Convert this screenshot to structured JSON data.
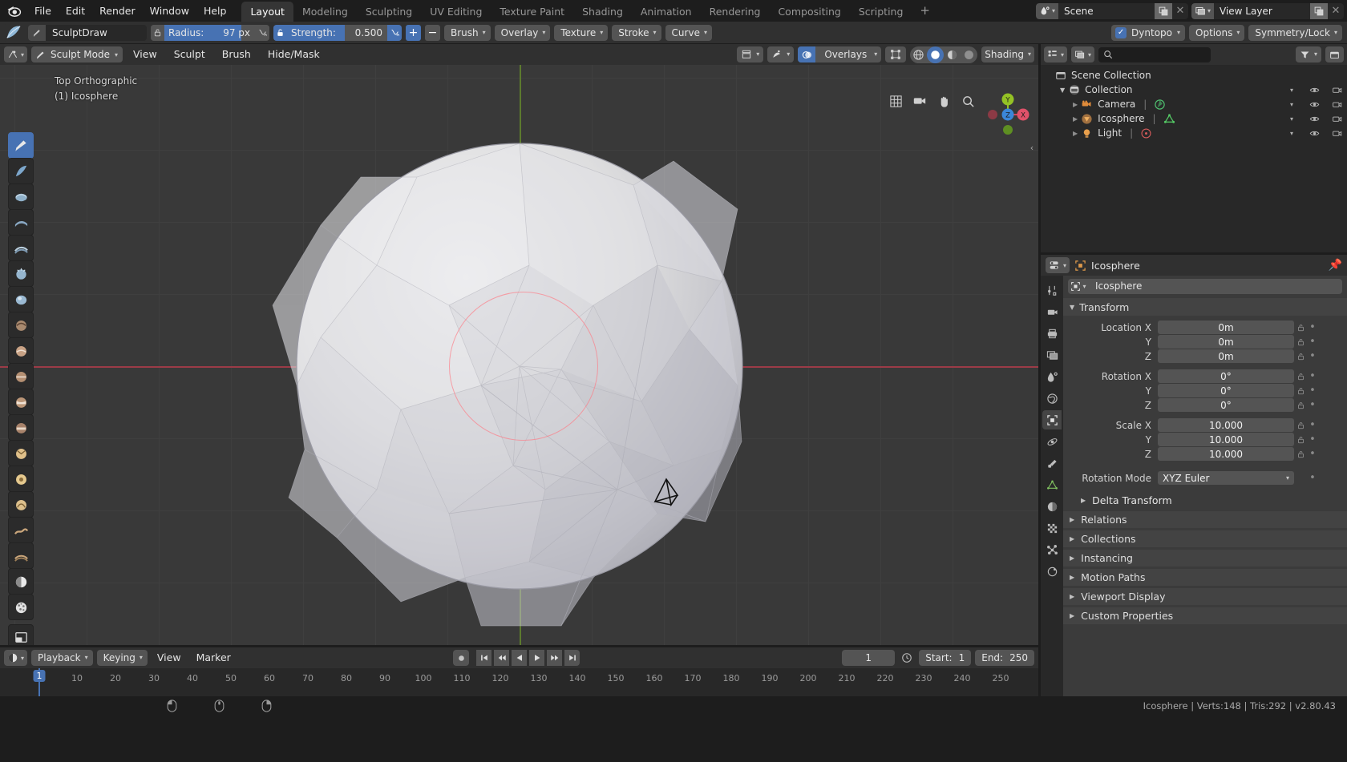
{
  "topbar": {
    "menus": [
      "File",
      "Edit",
      "Render",
      "Window",
      "Help"
    ],
    "workspaces": [
      {
        "label": "Layout",
        "active": true
      },
      {
        "label": "Modeling",
        "active": false
      },
      {
        "label": "Sculpting",
        "active": false
      },
      {
        "label": "UV Editing",
        "active": false
      },
      {
        "label": "Texture Paint",
        "active": false
      },
      {
        "label": "Shading",
        "active": false
      },
      {
        "label": "Animation",
        "active": false
      },
      {
        "label": "Rendering",
        "active": false
      },
      {
        "label": "Compositing",
        "active": false
      },
      {
        "label": "Scripting",
        "active": false
      }
    ],
    "add_workspace": "+",
    "scene_name": "Scene",
    "view_layer_name": "View Layer"
  },
  "toolbar": {
    "brush_name": "SculptDraw",
    "radius_label": "Radius:",
    "radius_value": "97 px",
    "strength_label": "Strength:",
    "strength_value": "0.500",
    "plus": "+",
    "minus": "−",
    "menus": [
      "Brush",
      "Overlay",
      "Texture",
      "Stroke",
      "Curve"
    ],
    "dyntopo_label": "Dyntopo",
    "dyntopo_checked": true,
    "options_label": "Options",
    "symmetry_label": "Symmetry/Lock"
  },
  "viewport": {
    "mode": "Sculpt Mode",
    "menus": [
      "View",
      "Sculpt",
      "Brush",
      "Hide/Mask"
    ],
    "overlays_label": "Overlays",
    "shading_label": "Shading",
    "view_name": "Top Orthographic",
    "object_info": "(1) Icosphere",
    "gizmo_axes": {
      "x": "X",
      "y": "Y",
      "z": "Z"
    }
  },
  "outliner": {
    "search_placeholder": "",
    "rows": [
      {
        "name": "Scene Collection",
        "icon": "collection-icon",
        "depth": 0,
        "expander": "",
        "datatype": ""
      },
      {
        "name": "Collection",
        "icon": "collection-icon",
        "depth": 1,
        "expander": "▼",
        "datatype": ""
      },
      {
        "name": "Camera",
        "icon": "camera-icon",
        "depth": 2,
        "expander": "▶",
        "datatype": "camera-data-icon"
      },
      {
        "name": "Icosphere",
        "icon": "mesh-object-icon",
        "depth": 2,
        "expander": "▶",
        "datatype": "mesh-data-icon"
      },
      {
        "name": "Light",
        "icon": "light-icon",
        "depth": 2,
        "expander": "▶",
        "datatype": "light-data-icon"
      }
    ]
  },
  "properties": {
    "breadcrumb_object": "Icosphere",
    "object_name_field": "Icosphere",
    "transform_title": "Transform",
    "rows": [
      {
        "label": "Location X",
        "value": "0m"
      },
      {
        "label": "Y",
        "value": "0m"
      },
      {
        "label": "Z",
        "value": "0m"
      },
      {
        "label": "Rotation X",
        "value": "0°"
      },
      {
        "label": "Y",
        "value": "0°"
      },
      {
        "label": "Z",
        "value": "0°"
      },
      {
        "label": "Scale X",
        "value": "10.000"
      },
      {
        "label": "Y",
        "value": "10.000"
      },
      {
        "label": "Z",
        "value": "10.000"
      }
    ],
    "rotation_mode_label": "Rotation Mode",
    "rotation_mode_value": "XYZ Euler",
    "delta_transform": "Delta Transform",
    "panels": [
      "Relations",
      "Collections",
      "Instancing",
      "Motion Paths",
      "Viewport Display",
      "Custom Properties"
    ]
  },
  "timeline": {
    "menus": [
      "Playback",
      "Keying",
      "View",
      "Marker"
    ],
    "current_frame": "1",
    "start_label": "Start:",
    "start_value": "1",
    "end_label": "End:",
    "end_value": "250",
    "ticks": [
      "10",
      "20",
      "30",
      "40",
      "50",
      "60",
      "70",
      "80",
      "90",
      "100",
      "110",
      "120",
      "130",
      "140",
      "150",
      "160",
      "170",
      "180",
      "190",
      "200",
      "210",
      "220",
      "230",
      "240",
      "250"
    ],
    "playhead_label": "1"
  },
  "statusbar": {
    "info": "Icosphere | Verts:148 | Tris:292 | v2.80.43"
  },
  "colors": {
    "accent_blue": "#4772b3",
    "header_bg": "#303030",
    "viewport_bg": "#393939",
    "panel_bg": "#3b3b3b",
    "outliner_bg": "#282828",
    "axis_x": "#9b3b47",
    "axis_y": "#5c7a2e"
  }
}
